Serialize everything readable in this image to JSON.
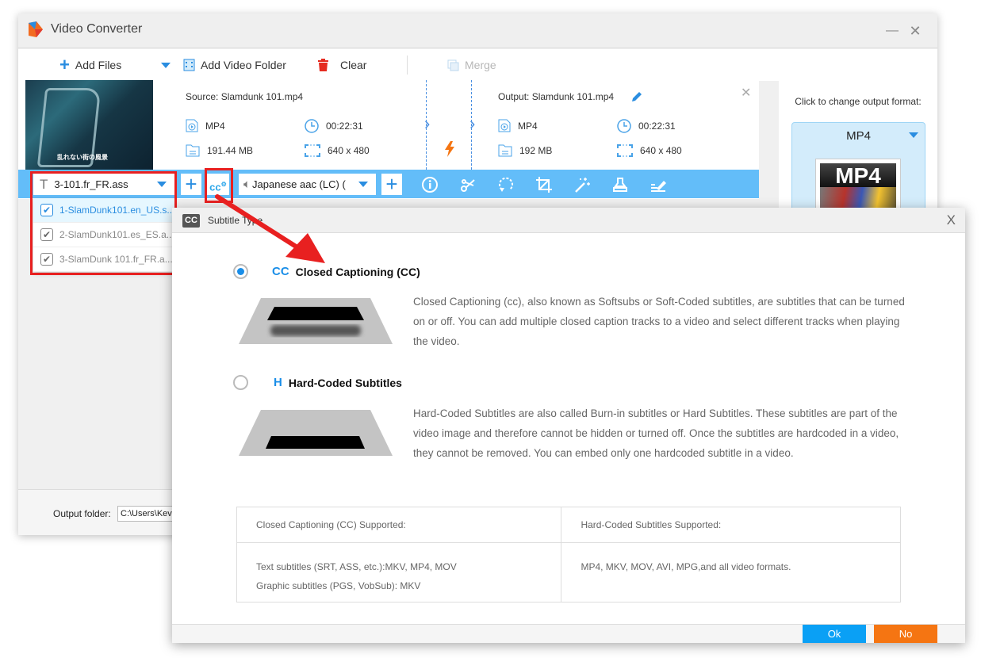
{
  "app": {
    "title": "Video Converter",
    "minimize_glyph": "—",
    "close_glyph": "✕"
  },
  "toolbar": {
    "add_files": "Add Files",
    "add_video_folder": "Add Video Folder",
    "clear": "Clear",
    "merge": "Merge"
  },
  "file": {
    "thumbnail_caption": "乱れない街の風景",
    "source": {
      "title": "Source: Slamdunk 101.mp4",
      "format": "MP4",
      "duration": "00:22:31",
      "size": "191.44 MB",
      "resolution": "640 x 480"
    },
    "output": {
      "title": "Output: Slamdunk 101.mp4",
      "format": "MP4",
      "duration": "00:22:31",
      "size": "192 MB",
      "resolution": "640 x 480"
    }
  },
  "edit_bar": {
    "subtitle_selected": "3-101.fr_FR.ass",
    "subtitle_icon": "T",
    "cc_label": "cc",
    "audio_selected": "Japanese aac (LC) (",
    "tools": [
      "info",
      "cut",
      "rotate",
      "crop",
      "effects",
      "watermark",
      "subtitle-edit"
    ]
  },
  "subtitle_options": [
    {
      "label": "1-SlamDunk101.en_US.s...",
      "checked": true,
      "active": true
    },
    {
      "label": "2-SlamDunk101.es_ES.a...",
      "checked": true,
      "active": false
    },
    {
      "label": "3-SlamDunk 101.fr_FR.a...",
      "checked": true,
      "active": false
    }
  ],
  "format_panel": {
    "label": "Click to change output format:",
    "format": "MP4",
    "image_text": "MP4"
  },
  "output_folder": {
    "label": "Output folder:",
    "value": "C:\\Users\\Kevin"
  },
  "dialog": {
    "icon": "CC",
    "title": "Subtitle Type",
    "close_glyph": "X",
    "cc_option": {
      "mark": "CC",
      "title": "Closed Captioning (CC)",
      "selected": true,
      "description": "Closed Captioning (cc), also known as Softsubs or Soft-Coded subtitles, are subtitles that can be turned on or off. You can add multiple closed caption tracks to a video and select different tracks when playing the video."
    },
    "hard_option": {
      "mark": "H",
      "title": "Hard-Coded Subtitles",
      "selected": false,
      "description": "Hard-Coded Subtitles are also called Burn-in subtitles or Hard Subtitles. These subtitles are part of the video image and therefore cannot be hidden or turned off. Once the subtitles are hardcoded in a video, they cannot be removed. You can embed only one hardcoded subtitle in a video."
    },
    "table": {
      "headers": [
        "Closed Captioning (CC) Supported:",
        "Hard-Coded Subtitles Supported:"
      ],
      "cc_lines": [
        "Text subtitles (SRT, ASS, etc.):MKV, MP4, MOV",
        "Graphic subtitles (PGS, VobSub): MKV"
      ],
      "hard_lines": [
        "MP4, MKV, MOV, AVI, MPG,and all video formats."
      ]
    },
    "ok": "Ok",
    "no": "No"
  },
  "colors": {
    "accent_blue": "#63bdf9",
    "ok_button": "#0aa0f5",
    "no_button": "#f57512",
    "annotation_red": "#e82020"
  }
}
